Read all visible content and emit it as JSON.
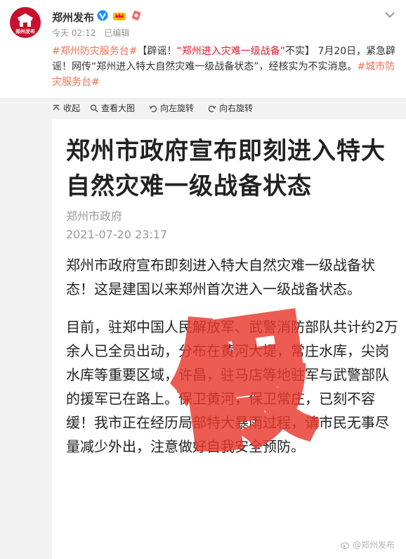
{
  "post": {
    "avatar_text": "郑州发布",
    "username": "郑州发布",
    "time": "今天 02:12",
    "edited": "已编辑",
    "text": {
      "tag1": "#郑州防灾服务台#",
      "part1": "【辟谣！",
      "quote_open": "“",
      "highlight": "郑州进入灾难一级战备",
      "quote_close": "”",
      "part2": "不实】 7月20日，紧急辟谣！网传“郑州进入特大自然灾难一级战备状态”，经核实为不实消息。",
      "tag2": "#城市防灾服务台#"
    }
  },
  "toolbar": {
    "collapse": "收起",
    "view_large": "查看大图",
    "rotate_left": "向左旋转",
    "rotate_right": "向右旋转"
  },
  "article": {
    "title": "郑州市政府宣布即刻进入特大自然灾难一级战备状态",
    "source": "郑州市政府",
    "date": "2021-07-20 23:17",
    "para1": "郑州市政府宣布即刻进入特大自然灾难一级战备状态！这是建国以来郑州首次进入一级战备状态。",
    "para2": "目前，驻郑中国人民解放军、武警消防部队共计约2万余人已全员出动，分布在黄河大堤，常庄水库，尖岗水库等重要区域，许昌，驻马店等地驻军与武警部队的援军已在路上。保卫黄河，保卫常庄，已刻不容缓！我市正在经历局部特大暴雨过程，请市民无事尽量减少外出，注意做好自我安全预防。",
    "stamp_text": "假",
    "watermark": "@郑州发布"
  },
  "colors": {
    "brand_red": "#c8102e",
    "tag_orange": "#eb7350",
    "highlight_red": "#e6162d",
    "stamp_red": "#e8392e"
  }
}
